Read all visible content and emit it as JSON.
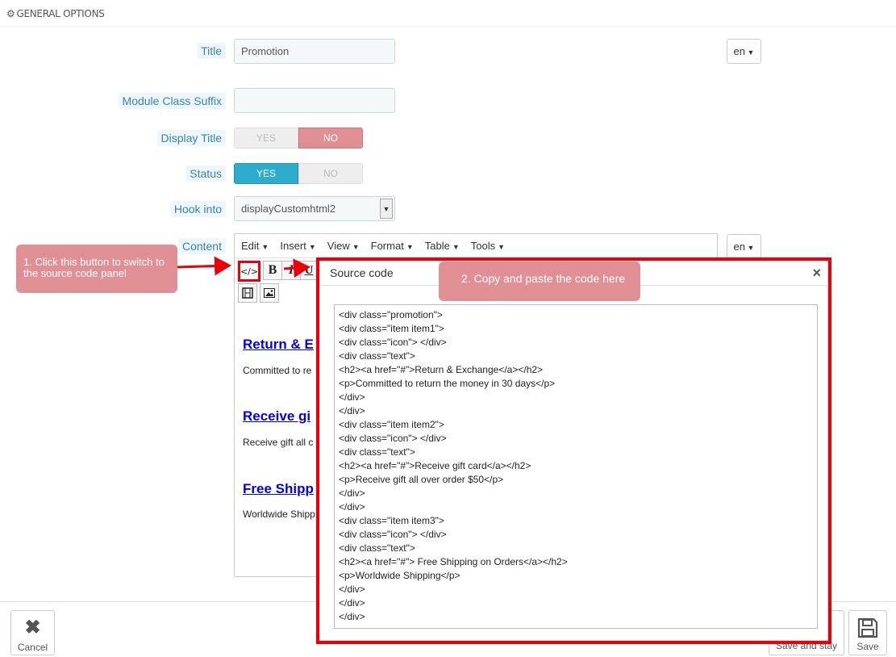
{
  "panel": {
    "heading": "GENERAL OPTIONS"
  },
  "fields": {
    "title": {
      "label": "Title",
      "value": "Promotion",
      "lang": "en"
    },
    "module_class_suffix": {
      "label": "Module Class Suffix",
      "value": ""
    },
    "display_title": {
      "label": "Display Title",
      "yes": "YES",
      "no": "NO",
      "selected": "NO"
    },
    "status": {
      "label": "Status",
      "yes": "YES",
      "no": "NO",
      "selected": "YES"
    },
    "hook_into": {
      "label": "Hook into",
      "value": "displayCustomhtml2"
    },
    "content": {
      "label": "Content",
      "lang": "en"
    }
  },
  "editor": {
    "menu": [
      "Edit",
      "Insert",
      "View",
      "Format",
      "Table",
      "Tools"
    ],
    "toolbar": {
      "source_code": "</>",
      "bold": "B",
      "italic": "I",
      "underline": "U"
    },
    "body": [
      {
        "heading": "Return & E",
        "text": "Committed to re"
      },
      {
        "heading": "Receive gi",
        "text": "Receive gift all c"
      },
      {
        "heading": "Free Shipp",
        "text": "Worldwide Shipp"
      }
    ]
  },
  "annotations": {
    "step1": "1. Click this button to switch to the source code panel",
    "step2": "2. Copy and paste the code here"
  },
  "source_dialog": {
    "title": "Source code",
    "close": "×",
    "code": "<div class=\"promotion\">\n<div class=\"item item1\">\n<div class=\"icon\"> </div>\n<div class=\"text\">\n<h2><a href=\"#\">Return & Exchange</a></h2>\n<p>Committed to return the money in 30 days</p>\n</div>\n</div>\n<div class=\"item item2\">\n<div class=\"icon\"> </div>\n<div class=\"text\">\n<h2><a href=\"#\">Receive gift card</a></h2>\n<p>Receive gift all over order $50</p>\n</div>\n</div>\n<div class=\"item item3\">\n<div class=\"icon\"> </div>\n<div class=\"text\">\n<h2><a href=\"#\"> Free Shipping on Orders</a></h2>\n<p>Worldwide Shipping</p>\n</div>\n</div>\n</div>"
  },
  "footer": {
    "cancel": "Cancel",
    "save_and_stay": "Save and stay",
    "save": "Save"
  },
  "colors": {
    "accent_red": "#e8000b",
    "callout": "#e08f95",
    "status_yes": "#2eacce"
  }
}
